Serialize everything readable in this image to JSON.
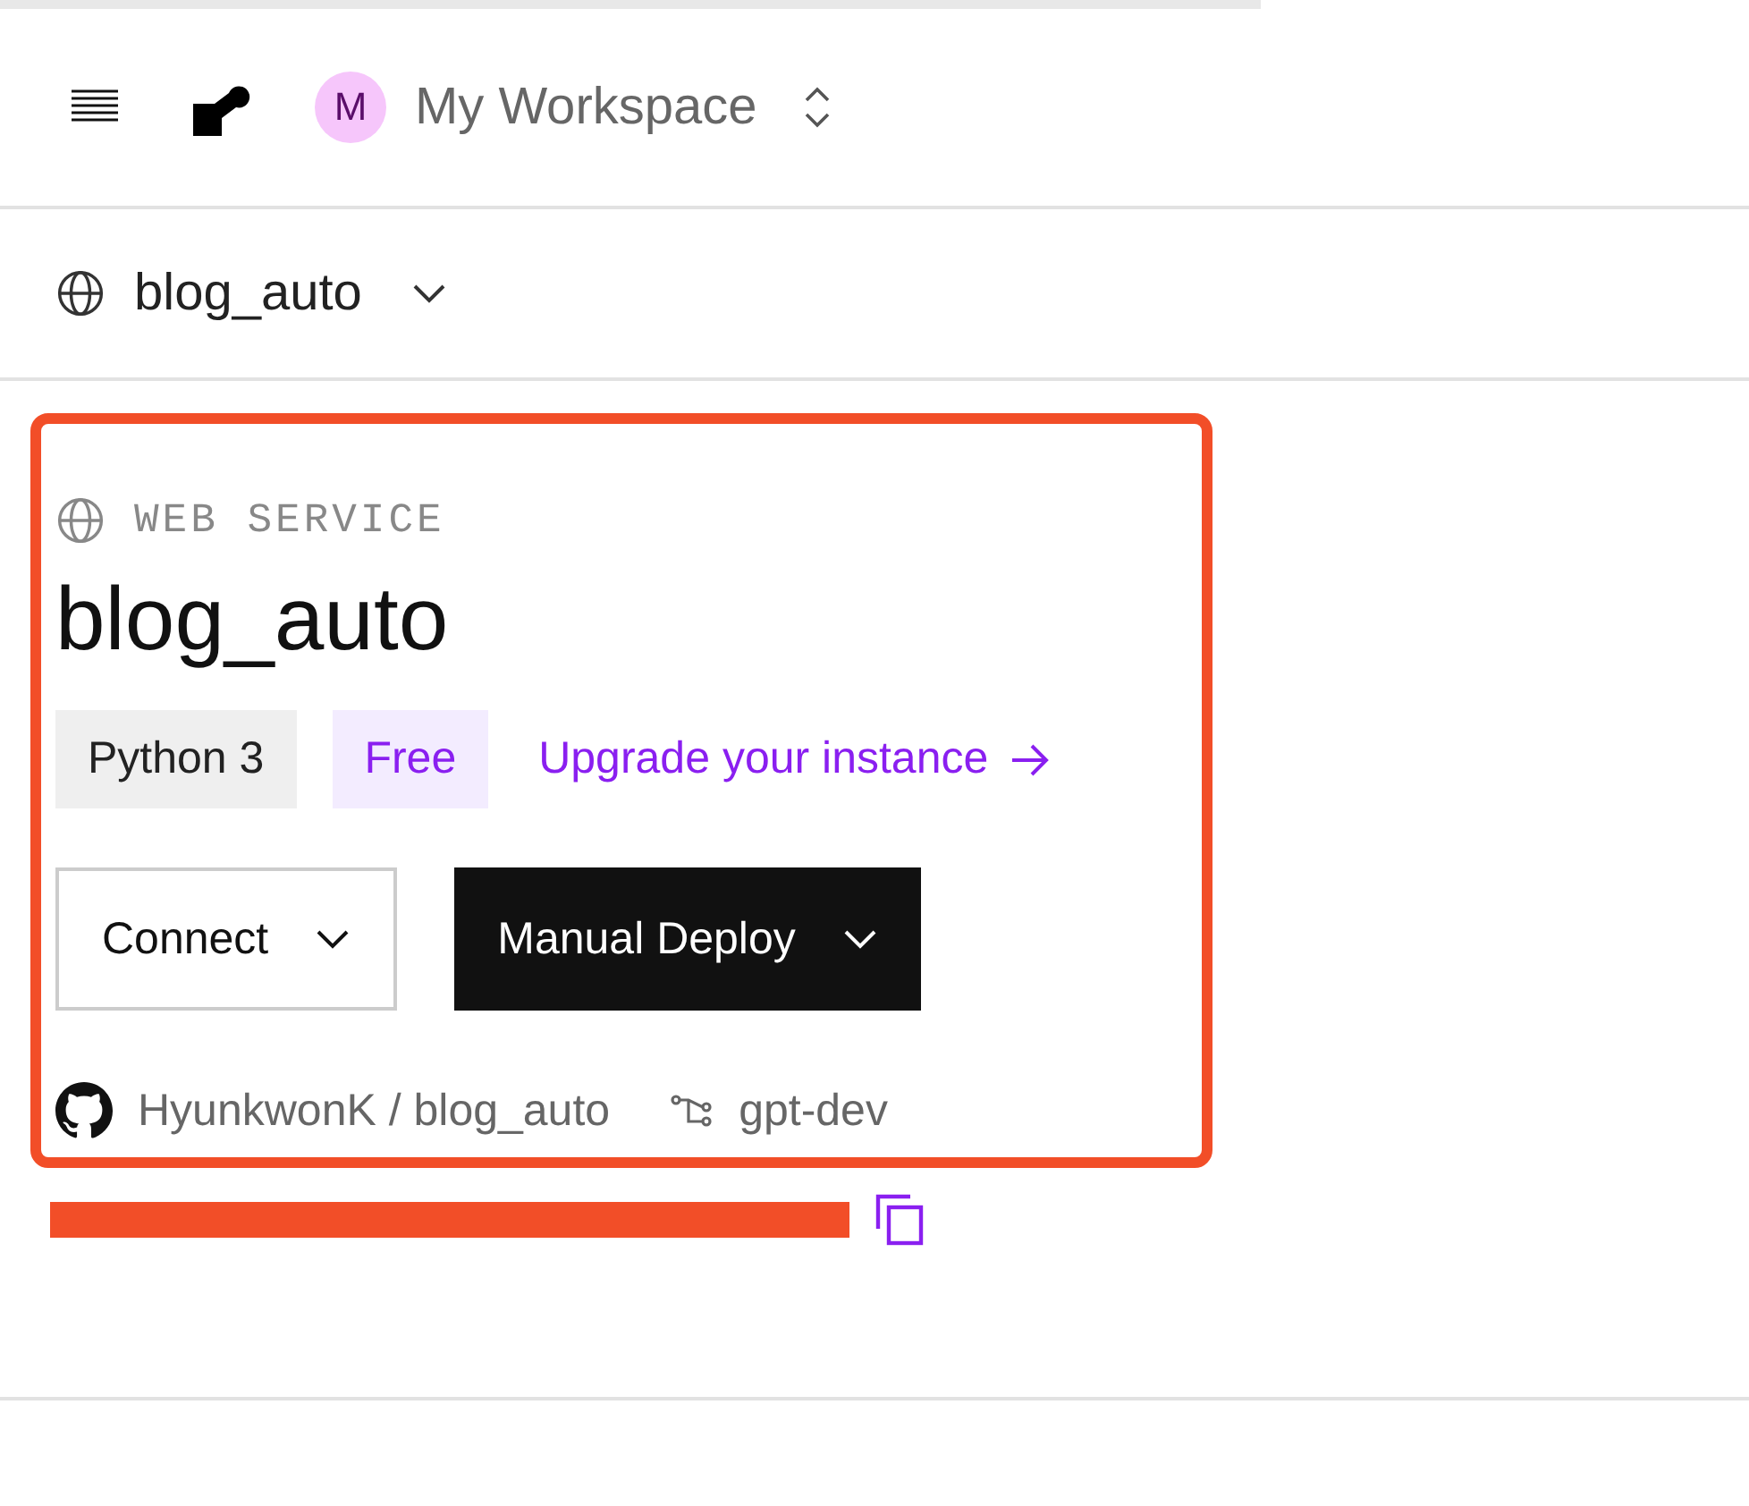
{
  "header": {
    "workspace_initial": "M",
    "workspace_name": "My Workspace"
  },
  "service_selector": {
    "name": "blog_auto"
  },
  "service": {
    "type_label": "WEB SERVICE",
    "name": "blog_auto",
    "tags": [
      {
        "label": "Python 3",
        "kind": "runtime"
      },
      {
        "label": "Free",
        "kind": "plan"
      }
    ],
    "upgrade_link": "Upgrade your instance",
    "buttons": [
      {
        "label": "Connect",
        "kind": "outline"
      },
      {
        "label": "Manual Deploy",
        "kind": "primary"
      }
    ],
    "repo": "HyunkwonK / blog_auto",
    "branch": "gpt-dev",
    "highlighted": true
  },
  "url": {
    "redacted": true
  }
}
